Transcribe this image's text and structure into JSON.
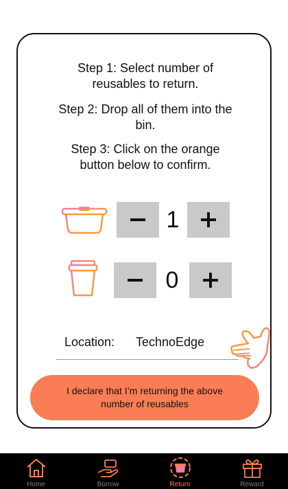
{
  "steps": {
    "step1_line1": "Step 1: Select number of",
    "step1_line2": "reusables to return.",
    "step2_line1": "Step 2: Drop all of them into the",
    "step2_line2": "bin.",
    "step3_line1": "Step 3: Click on the orange",
    "step3_line2": "button below to confirm."
  },
  "counters": [
    {
      "item": "container-icon",
      "value": "1"
    },
    {
      "item": "cup-icon",
      "value": "0"
    }
  ],
  "location": {
    "label": "Location:",
    "value": "TechnoEdge"
  },
  "confirm": {
    "line1": "I declare that I’m returning the above",
    "line2": "number of reusables"
  },
  "tabs": [
    {
      "label": "Home",
      "icon": "home-icon"
    },
    {
      "label": "Borrow",
      "icon": "borrow-hand-icon"
    },
    {
      "label": "Return",
      "icon": "return-icon",
      "active": true
    },
    {
      "label": "Reward",
      "icon": "gift-icon"
    }
  ],
  "colors": {
    "accent": "#fb7d55",
    "icon_gradient_start": "#f58a8a",
    "icon_gradient_end": "#f5a623",
    "button_gray": "#c9c9c9"
  }
}
